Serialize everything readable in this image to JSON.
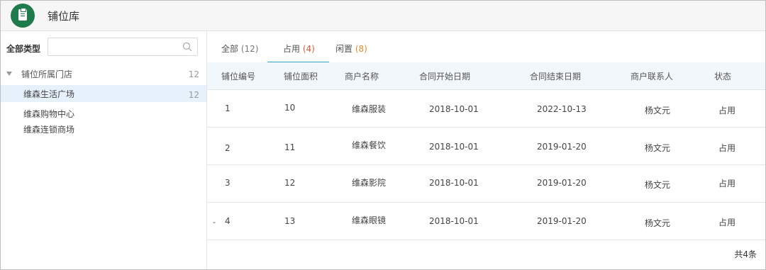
{
  "app": {
    "title": "铺位库"
  },
  "sidebar": {
    "filter_label": "全部类型",
    "search": {
      "value": "",
      "placeholder": ""
    },
    "tree_root": {
      "label": "铺位所属门店",
      "count": "12"
    },
    "items": [
      {
        "label": "维森生活广场",
        "count": "12",
        "active": true
      },
      {
        "label": "维森购物中心",
        "count": ""
      },
      {
        "label": "维森连锁商场",
        "count": ""
      }
    ]
  },
  "tabs": [
    {
      "label": "全部",
      "count": "(12)"
    },
    {
      "label": "占用",
      "count": "(4)",
      "active": true
    },
    {
      "label": "闲置",
      "count": "(8)"
    }
  ],
  "table": {
    "columns": [
      "铺位编号",
      "铺位面积",
      "商户名称",
      "合同开始日期",
      "合同结束日期",
      "商户联系人",
      "状态"
    ],
    "rows": [
      [
        "1",
        "10",
        "维森服装",
        "2018-10-01",
        "2022-10-13",
        "杨文元",
        "占用"
      ],
      [
        "2",
        "11",
        "维森餐饮",
        "2018-10-01",
        "2019-01-20",
        "杨文元",
        "占用"
      ],
      [
        "3",
        "12",
        "维森影院",
        "2018-10-01",
        "2019-01-20",
        "杨文元",
        "占用"
      ],
      [
        "4",
        "13",
        "维森眼镜",
        "2018-10-01",
        "2019-01-20",
        "杨文元",
        "占用"
      ]
    ]
  },
  "pager": {
    "total": "共4条"
  },
  "colors": {
    "brand": "#1f7a4c",
    "tab_active": "#35a3c9",
    "row_active": "#e6f1fb"
  },
  "icons": {
    "logo": "clipboard-icon",
    "search": "search-icon",
    "caret": "caret-down-icon"
  }
}
